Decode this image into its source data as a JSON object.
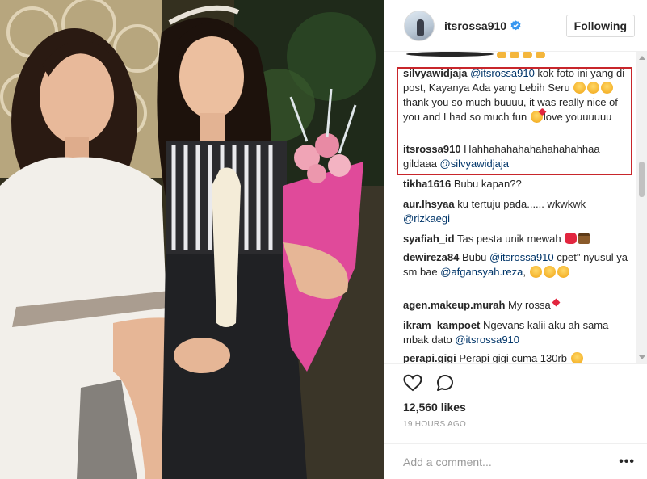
{
  "header": {
    "username": "itsrossa910",
    "follow_label": "Following"
  },
  "comments": [
    {
      "user": "silvyawidjaja",
      "mention": "@itsrossa910",
      "text1": " kok foto ini yang di post, Kayanya Ada yang Lebih Seru ",
      "text2": " thank you so much buuuu, it was really nice of you and I had so much fun ",
      "text3": "love youuuuuu"
    },
    {
      "user": "itsrossa910",
      "text1": " Hahhahahahahahahahahhaa gildaaa ",
      "mention": "@silvyawidjaja"
    },
    {
      "user": "tikha1616",
      "text1": " Bubu kapan??"
    },
    {
      "user": "aur.lhsyaa",
      "text1": " ku tertuju pada...... wkwkwk ",
      "mention": "@rizkaegi"
    },
    {
      "user": "syafiah_id",
      "text1": " Tas pesta unik mewah "
    },
    {
      "user": "dewireza84",
      "text1": " Bubu ",
      "mention": "@itsrossa910",
      "text2": " cpet\" nyusul ya sm bae ",
      "mention2": "@afgansyah.reza",
      "text3": ", "
    },
    {
      "user": "agen.makeup.murah",
      "text1": " My rossa"
    },
    {
      "user": "ikram_kampoet",
      "text1": " Ngevans kalii aku ah sama mbak dato ",
      "mention": "@itsrossa910"
    },
    {
      "user": "perapi.gigi",
      "text1": " Perapi gigi cuma 130rb "
    }
  ],
  "likes": "12,560 likes",
  "timestamp": "19 HOURS AGO",
  "add_comment": {
    "placeholder": "Add a comment..."
  },
  "more_label": "•••",
  "icons": {
    "like": "heart-outline-icon",
    "comment": "speech-bubble-icon",
    "verified": "verified-badge-icon",
    "more": "ellipsis-icon"
  },
  "colors": {
    "highlight_box": "#c8262b",
    "mention": "#003569",
    "verified": "#3897f0"
  }
}
